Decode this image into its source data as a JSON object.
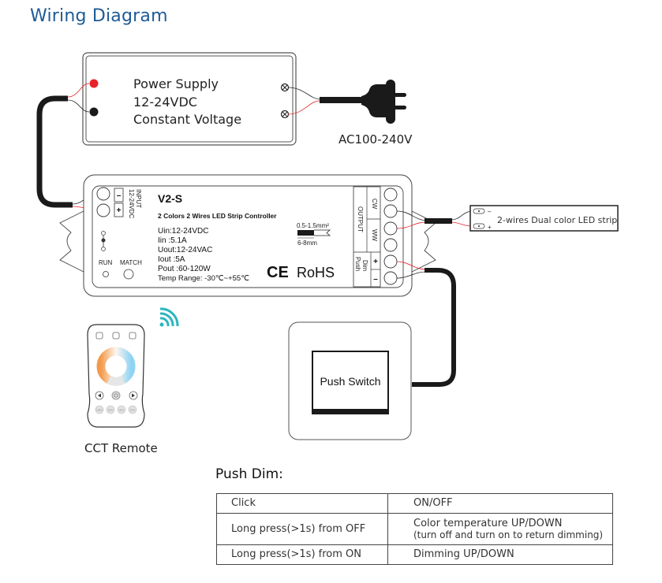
{
  "title": "Wiring Diagram",
  "power_supply": {
    "line1": "Power Supply",
    "line2": "12-24VDC",
    "line3": "Constant Voltage"
  },
  "ac_plug": {
    "label": "AC100-240V"
  },
  "controller": {
    "model": "V2-S",
    "description": "2 Colors 2 Wires LED Strip Controller",
    "specs": [
      "Uin:12-24VDC",
      "Iin :5.1A",
      "Uout:12-24VAC",
      "Iout :5A",
      "Pout :60-120W",
      "Temp Range: -30℃~+55℃"
    ],
    "input_label": "INPUT",
    "input_voltage": "12-24VDC",
    "input_minus": "–",
    "input_plus": "+",
    "run_label": "RUN",
    "match_label": "MATCH",
    "wire_gauge": "0.5-1.5mm²",
    "strip_length": "6-8mm",
    "ce_mark": "CE",
    "rohs": "RoHS",
    "output_label": "OUTPUT",
    "output_cw": "CW",
    "output_ww": "WW",
    "push_dim_label_1": "Push",
    "push_dim_label_2": "Dim",
    "push_plus": "+",
    "push_minus": "–"
  },
  "led_strip": {
    "label": "2-wires Dual color LED strip",
    "minus": "–",
    "plus": "+"
  },
  "remote": {
    "label": "CCT Remote",
    "presets": [
      "100%",
      "50%",
      "25%",
      "10%"
    ]
  },
  "push_switch": {
    "label": "Push Switch"
  },
  "push_dim": {
    "title": "Push Dim:",
    "rows": [
      {
        "action": "Click",
        "result": "ON/OFF",
        "note": ""
      },
      {
        "action": "Long press(>1s) from OFF",
        "result": "Color temperature UP/DOWN",
        "note": "(turn off and turn on to return dimming)"
      },
      {
        "action": "Long press(>1s) from ON",
        "result": "Dimming UP/DOWN",
        "note": ""
      }
    ]
  },
  "colors": {
    "title_blue": "#1e5b96",
    "wire_red": "#e8222a",
    "cable_black": "#1a1a1a",
    "wifi_teal": "#2bb5c0",
    "warm_orange": "#f39a4c",
    "cool_blue": "#8fd3f4"
  }
}
